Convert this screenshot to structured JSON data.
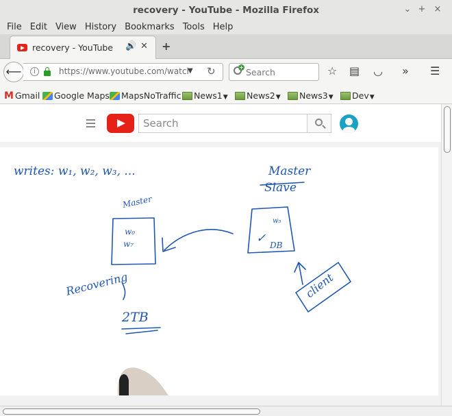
{
  "window": {
    "title": "recovery - YouTube - Mozilla Firefox",
    "controls": [
      "⌄",
      "+",
      "×"
    ]
  },
  "menu": [
    "File",
    "Edit",
    "View",
    "History",
    "Bookmarks",
    "Tools",
    "Help"
  ],
  "tab": {
    "label": "recovery - YouTube",
    "new_tab": "+"
  },
  "nav": {
    "url": "https://www.youtube.com/watch?",
    "search_placeholder": "Search"
  },
  "bookmarks": [
    {
      "label": "Gmail",
      "icon": "gmail-icon"
    },
    {
      "label": "Google Maps",
      "icon": "maps-icon"
    },
    {
      "label": "MapsNoTraffic",
      "icon": "maps-icon"
    },
    {
      "label": "News1",
      "icon": "folder-icon",
      "dropdown": true
    },
    {
      "label": "News2",
      "icon": "folder-icon",
      "dropdown": true
    },
    {
      "label": "News3",
      "icon": "folder-icon",
      "dropdown": true
    },
    {
      "label": "Dev",
      "icon": "folder-icon",
      "dropdown": true
    }
  ],
  "youtube": {
    "search_placeholder": "Search"
  },
  "whiteboard": {
    "writes": "writes: w₁, w₂, w₃, ...",
    "master_left": "Master",
    "box_left_line1": "w₀",
    "box_left_line2": "w₇",
    "recovering": "Recovering",
    "storage": "2TB",
    "master_right": "Master",
    "slave_right": "Slave",
    "box_right_line1": "w₅",
    "box_right_check": "✓",
    "box_right_mark": "DB",
    "client": "client"
  }
}
